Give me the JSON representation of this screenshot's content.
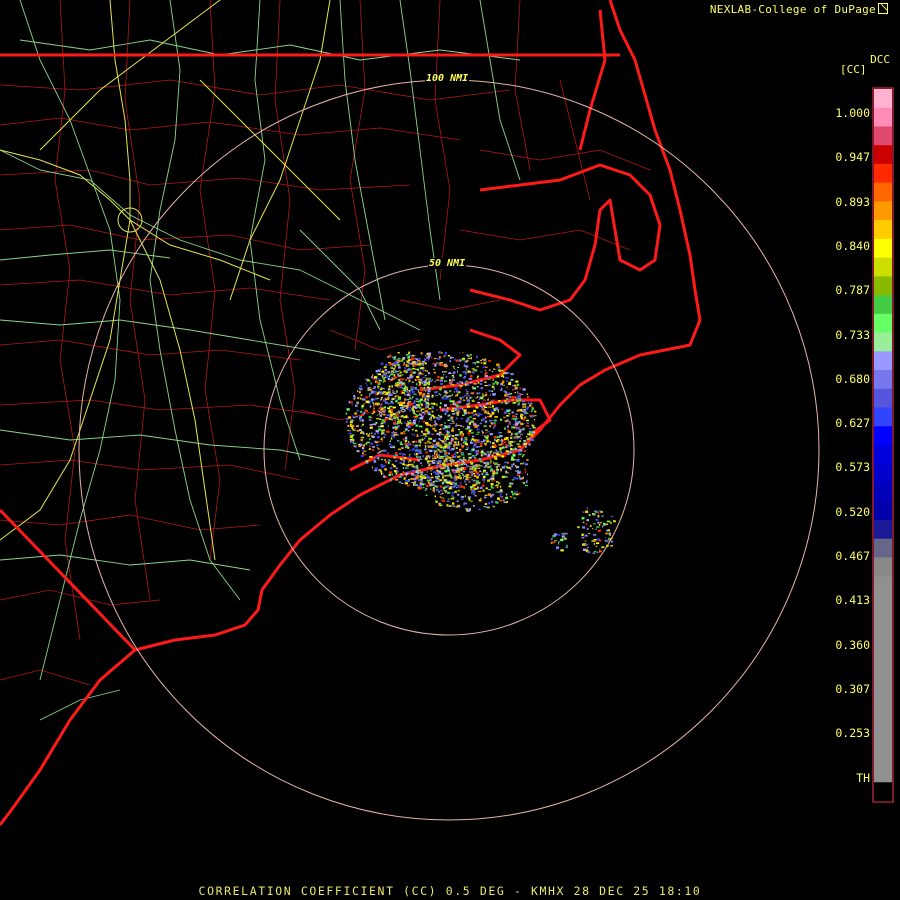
{
  "header": {
    "credit": "NEXLAB-College of DuPage"
  },
  "icons": {
    "credit_icon": "external-link-icon"
  },
  "legend": {
    "product_code": "DCC",
    "unit": "[CC]",
    "ticks": [
      "1.000",
      "0.947",
      "0.893",
      "0.840",
      "0.787",
      "0.733",
      "0.680",
      "0.627",
      "0.573",
      "0.520",
      "0.467",
      "0.413",
      "0.360",
      "0.307",
      "0.253",
      "TH"
    ],
    "color_steps": [
      "#ffb3d1",
      "#ff8cb6",
      "#e04870",
      "#cc0000",
      "#ff2a00",
      "#ff6600",
      "#ff9900",
      "#ffcc00",
      "#ffff00",
      "#ccdd00",
      "#88bb00",
      "#44cc44",
      "#66ff66",
      "#99ee99",
      "#9999ff",
      "#7777ee",
      "#5555dd",
      "#3344ff",
      "#0000ff",
      "#0000dd",
      "#0000cc",
      "#0000bb",
      "#0000aa",
      "#1a1a99",
      "#666688",
      "#888888",
      "#909090",
      "#909090",
      "#909090",
      "#909090",
      "#909090",
      "#909090",
      "#909090",
      "#909090",
      "#909090",
      "#909090",
      "#909090",
      "#000000"
    ]
  },
  "rings": [
    {
      "label": "50 NMI"
    },
    {
      "label": "100 NMI"
    }
  ],
  "footer": {
    "caption": "CORRELATION COEFFICIENT (CC) 0.5 DEG - KMHX 28 DEC 25 18:10"
  },
  "colors": {
    "state_border": "#ff1a1a",
    "county": "#b01818",
    "highway": "#88d888",
    "interstate": "#e6e64c",
    "range_ring": "#e8b4a8",
    "text": "#ffff66"
  }
}
